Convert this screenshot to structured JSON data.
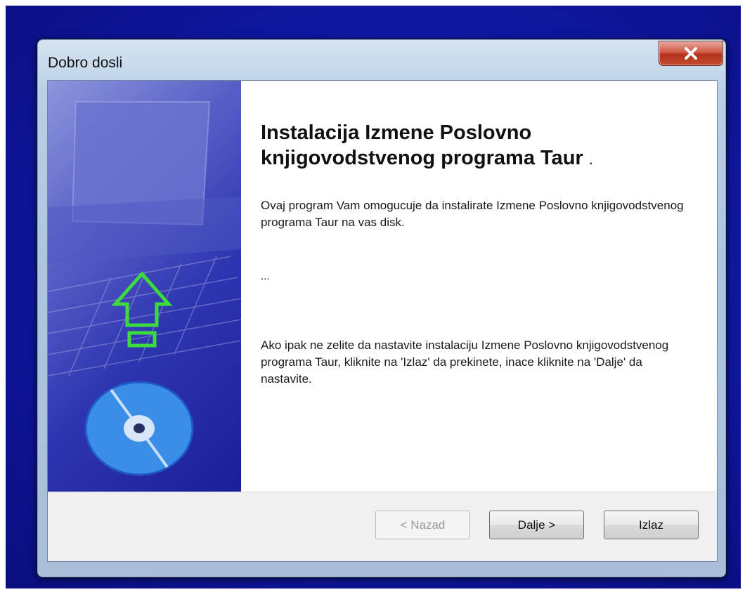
{
  "window": {
    "title": "Dobro dosli",
    "close_label": "×"
  },
  "content": {
    "heading": "Instalacija  Izmene Poslovno knjigovodstvenog programa Taur",
    "heading_suffix": ".",
    "paragraph1": "Ovaj program Vam omogucuje da instalirate Izmene Poslovno knjigovodstvenog programa Taur na vas disk.",
    "paragraph2": "...",
    "paragraph3": "Ako ipak ne zelite da nastavite instalaciju Izmene Poslovno knjigovodstvenog programa Taur, kliknite na 'Izlaz' da prekinete, inace kliknite na 'Dalje' da nastavite."
  },
  "buttons": {
    "back": {
      "label": "< Nazad",
      "enabled": false
    },
    "next": {
      "label": "Dalje >",
      "enabled": true
    },
    "exit": {
      "label": "Izlaz",
      "enabled": true
    }
  },
  "icons": {
    "sidebar_art": "setup-banner-computer-disc",
    "arrow": "up-arrow-icon",
    "disc": "cd-disc-icon",
    "close": "close-icon"
  },
  "colors": {
    "desktop": "#1420b0",
    "sidebar": "#2e35b0",
    "arrow": "#3ddc3d"
  }
}
